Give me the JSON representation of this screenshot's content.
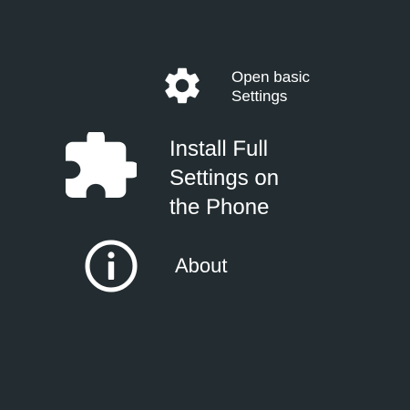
{
  "menu": {
    "items": [
      {
        "label": "Open basic Settings",
        "icon": "gear-icon"
      },
      {
        "label": "Install Full Settings on the Phone",
        "icon": "puzzle-piece-icon"
      },
      {
        "label": "About",
        "icon": "info-icon"
      }
    ]
  },
  "colors": {
    "background": "#232d31",
    "foreground": "#ffffff"
  }
}
